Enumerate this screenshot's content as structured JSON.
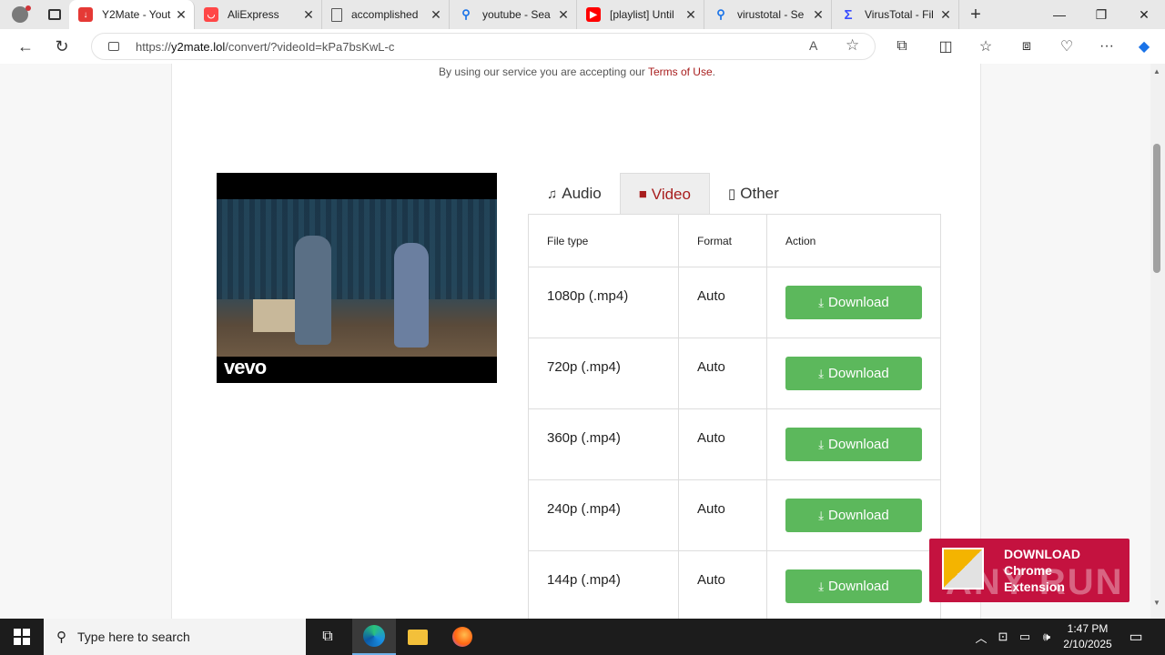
{
  "browser": {
    "tabs": [
      {
        "title": "Y2Mate - Yout",
        "active": true,
        "favicon_color": "#e53935"
      },
      {
        "title": "AliExpress",
        "active": false,
        "favicon_color": "#ff4747"
      },
      {
        "title": "accomplished",
        "active": false,
        "favicon_color": "#777777"
      },
      {
        "title": "youtube - Sea",
        "active": false,
        "favicon_color": "#1a73e8"
      },
      {
        "title": "[playlist] Until",
        "active": false,
        "favicon_color": "#ff0000"
      },
      {
        "title": "virustotal - Se",
        "active": false,
        "favicon_color": "#1a73e8"
      },
      {
        "title": "VirusTotal - Fil",
        "active": false,
        "favicon_color": "#394eff"
      }
    ],
    "url_prefix": "https://",
    "url_host": "y2mate.lol",
    "url_path": "/convert/?videoId=kPa7bsKwL-c"
  },
  "page": {
    "terms_text": "By using our service you are accepting our",
    "terms_link": "Terms of Use",
    "terms_end": ".",
    "video_overlay": "vevo",
    "format_tabs": [
      {
        "label": "Audio",
        "icon": "music-icon",
        "active": false
      },
      {
        "label": "Video",
        "icon": "video-camera-icon",
        "active": true
      },
      {
        "label": "Other",
        "icon": "file-icon",
        "active": false
      }
    ],
    "table": {
      "headers": [
        "File type",
        "Format",
        "Action"
      ],
      "rows": [
        {
          "file_type": "1080p (.mp4)",
          "format": "Auto",
          "action": "Download"
        },
        {
          "file_type": "720p (.mp4)",
          "format": "Auto",
          "action": "Download"
        },
        {
          "file_type": "360p (.mp4)",
          "format": "Auto",
          "action": "Download"
        },
        {
          "file_type": "240p (.mp4)",
          "format": "Auto",
          "action": "Download"
        },
        {
          "file_type": "144p (.mp4)",
          "format": "Auto",
          "action": "Download"
        }
      ]
    },
    "promo": {
      "line1": "DOWNLOAD",
      "line2": "Chrome",
      "line3": "Extension",
      "watermark": "ANY RUN"
    }
  },
  "taskbar": {
    "search_placeholder": "Type here to search",
    "time": "1:47 PM",
    "date": "2/10/2025"
  },
  "colors": {
    "accent": "#a81d1d",
    "download_button": "#5cb85c",
    "promo_bg": "#c4123f"
  }
}
